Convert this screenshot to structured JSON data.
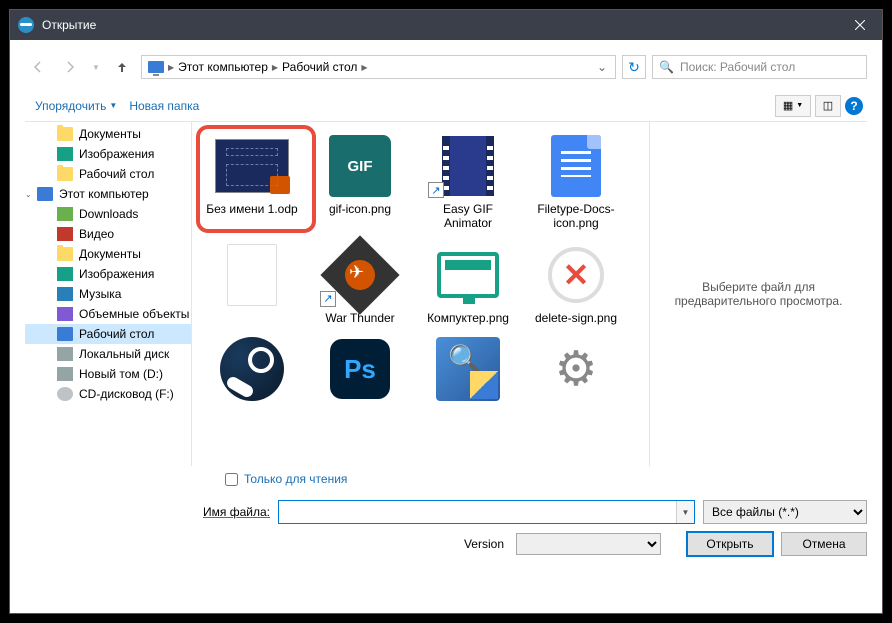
{
  "titlebar": {
    "title": "Открытие"
  },
  "nav": {
    "path": [
      {
        "icon": "pc",
        "label": "Этот компьютер"
      },
      {
        "label": "Рабочий стол"
      }
    ],
    "search_placeholder": "Поиск: Рабочий стол"
  },
  "toolbar": {
    "organize": "Упорядочить",
    "new_folder": "Новая папка"
  },
  "sidebar": [
    {
      "level": 1,
      "icon": "folder",
      "label": "Документы"
    },
    {
      "level": 1,
      "icon": "pic-icon",
      "label": "Изображения"
    },
    {
      "level": 1,
      "icon": "folder",
      "label": "Рабочий стол"
    },
    {
      "level": 0,
      "icon": "pc",
      "label": "Этот компьютер",
      "expand": "v"
    },
    {
      "level": 1,
      "icon": "dl-icon",
      "label": "Downloads"
    },
    {
      "level": 1,
      "icon": "vid-icon",
      "label": "Видео"
    },
    {
      "level": 1,
      "icon": "folder",
      "label": "Документы"
    },
    {
      "level": 1,
      "icon": "pic-icon",
      "label": "Изображения"
    },
    {
      "level": 1,
      "icon": "mus-icon",
      "label": "Музыка"
    },
    {
      "level": 1,
      "icon": "obj-icon",
      "label": "Объемные объекты"
    },
    {
      "level": 1,
      "icon": "pc",
      "label": "Рабочий стол",
      "selected": true
    },
    {
      "level": 1,
      "icon": "disk-icon",
      "label": "Локальный диск"
    },
    {
      "level": 1,
      "icon": "disk-icon",
      "label": "Новый том (D:)"
    },
    {
      "level": 1,
      "icon": "cd-icon",
      "label": "CD-дисковод (F:)"
    }
  ],
  "files": [
    {
      "thumb": "odp",
      "label": "Без имени 1.odp",
      "highlighted": true
    },
    {
      "thumb": "gif",
      "label": "gif-icon.png"
    },
    {
      "thumb": "film",
      "label": "Easy GIF Animator",
      "shortcut": true
    },
    {
      "thumb": "docs",
      "label": "Filetype-Docs-icon.png"
    },
    {
      "thumb": "blank",
      "label": ""
    },
    {
      "thumb": "wt",
      "label": "War Thunder",
      "shortcut": true
    },
    {
      "thumb": "monitor",
      "label": "Компуктер.png"
    },
    {
      "thumb": "x",
      "label": "delete-sign.png"
    },
    {
      "thumb": "steam",
      "label": ""
    },
    {
      "thumb": "ps",
      "label": ""
    },
    {
      "thumb": "scan",
      "label": ""
    },
    {
      "thumb": "gear",
      "label": ""
    }
  ],
  "preview": {
    "text": "Выберите файл для предварительного просмотра."
  },
  "readonly": {
    "label": "Только для чтения"
  },
  "bottom": {
    "filename_label": "Имя файла:",
    "filename_value": "",
    "filetype_value": "Все файлы (*.*)",
    "version_label": "Version",
    "open": "Открыть",
    "cancel": "Отмена"
  }
}
